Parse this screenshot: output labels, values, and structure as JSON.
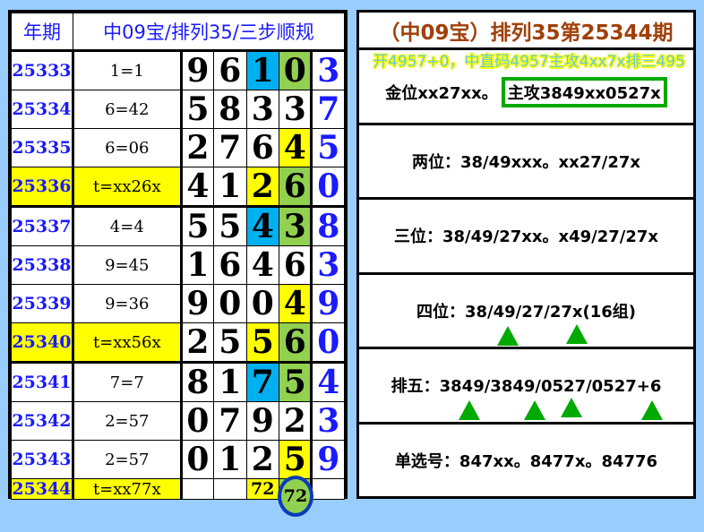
{
  "left": {
    "header": [
      "年期",
      "中09宝/排列35/三步顺规"
    ],
    "rows": [
      {
        "period": "25333",
        "rule": "1=1",
        "hl": false,
        "digits": [
          "9",
          "6",
          "1",
          "0",
          "3"
        ],
        "colors": [
          "",
          "",
          "B",
          "G",
          ""
        ]
      },
      {
        "period": "25334",
        "rule": "6=42",
        "hl": false,
        "digits": [
          "5",
          "8",
          "3",
          "3",
          "7"
        ],
        "colors": [
          "",
          "",
          "",
          "",
          ""
        ]
      },
      {
        "period": "25335",
        "rule": "6=06",
        "hl": false,
        "digits": [
          "2",
          "7",
          "6",
          "4",
          "5"
        ],
        "colors": [
          "",
          "",
          "",
          "Y",
          ""
        ]
      },
      {
        "period": "25336",
        "rule": "t=xx26x",
        "hl": true,
        "digits": [
          "4",
          "1",
          "2",
          "6",
          "0"
        ],
        "colors": [
          "",
          "",
          "Y",
          "G",
          ""
        ]
      },
      {
        "period": "25337",
        "rule": "4=4",
        "hl": false,
        "digits": [
          "5",
          "5",
          "4",
          "3",
          "8"
        ],
        "colors": [
          "",
          "",
          "B",
          "G",
          ""
        ]
      },
      {
        "period": "25338",
        "rule": "9=45",
        "hl": false,
        "digits": [
          "1",
          "6",
          "4",
          "6",
          "3"
        ],
        "colors": [
          "",
          "",
          "",
          "",
          ""
        ]
      },
      {
        "period": "25339",
        "rule": "9=36",
        "hl": false,
        "digits": [
          "9",
          "0",
          "0",
          "4",
          "9"
        ],
        "colors": [
          "",
          "",
          "",
          "Y",
          ""
        ]
      },
      {
        "period": "25340",
        "rule": "t=xx56x",
        "hl": true,
        "digits": [
          "2",
          "5",
          "5",
          "6",
          "0"
        ],
        "colors": [
          "",
          "",
          "Y",
          "G",
          ""
        ]
      },
      {
        "period": "25341",
        "rule": "7=7",
        "hl": false,
        "digits": [
          "8",
          "1",
          "7",
          "5",
          "4"
        ],
        "colors": [
          "",
          "",
          "B",
          "G",
          ""
        ]
      },
      {
        "period": "25342",
        "rule": "2=57",
        "hl": false,
        "digits": [
          "0",
          "7",
          "9",
          "2",
          "3"
        ],
        "colors": [
          "",
          "",
          "",
          "",
          ""
        ]
      },
      {
        "period": "25343",
        "rule": "2=57",
        "hl": false,
        "digits": [
          "0",
          "1",
          "2",
          "5",
          "9"
        ],
        "colors": [
          "",
          "",
          "",
          "Y",
          ""
        ]
      },
      {
        "period": "25344",
        "rule": "t=xx77x",
        "hl": true,
        "digits": [
          "",
          "",
          "72",
          "72",
          ""
        ],
        "colors": [
          "",
          "",
          "Y",
          "G",
          ""
        ]
      }
    ]
  },
  "right": {
    "title": "（中09宝）排列35第25344期",
    "banner": "开4957+0，中直码4957主攻4xx7x排三495",
    "gold": "金位xx27xx。",
    "main_attack": "主攻3849xx0527x",
    "two": "两位：38/49xxx。xx27/27x",
    "three": "三位：38/49/27xx。x49/27/27x",
    "four": "四位：38/49/27/27x(16组)",
    "five": "排五：3849/3849/0527/0527+6",
    "single": "单选号：847xx。8477x。84776"
  },
  "colors": {
    "Y": "#ffff00",
    "B": "#00b0f0",
    "G": "#92d050",
    "accent": "#00aa00"
  }
}
